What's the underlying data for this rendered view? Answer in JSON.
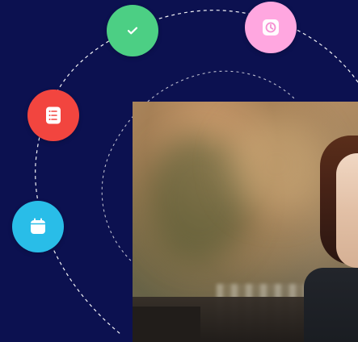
{
  "colors": {
    "background": "#0c1150",
    "check_circle": "#4ccf84",
    "clock_circle": "#ffa7e0",
    "list_circle": "#f2453f",
    "calendar_circle": "#29bde8",
    "orbit_line": "#ffffff"
  },
  "icons": [
    {
      "name": "check-icon"
    },
    {
      "name": "clock-icon"
    },
    {
      "name": "list-icon"
    },
    {
      "name": "calendar-icon"
    }
  ]
}
